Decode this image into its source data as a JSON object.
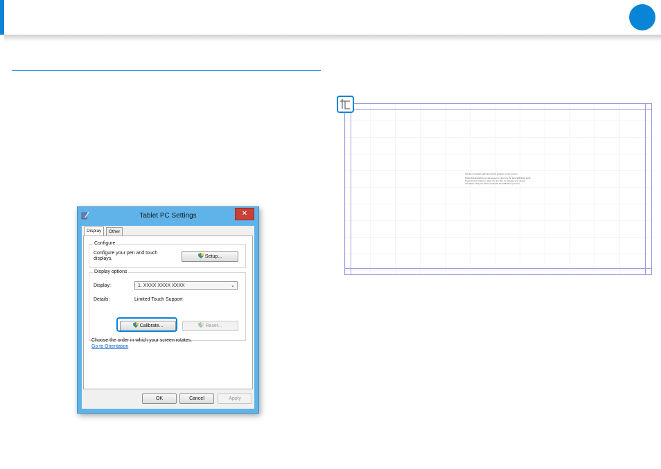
{
  "dialog": {
    "title": "Tablet PC Settings",
    "close_glyph": "✕",
    "tabs": [
      {
        "label": "Display",
        "active": true
      },
      {
        "label": "Other",
        "active": false
      }
    ],
    "configure": {
      "group_label": "Configure",
      "text": "Configure your pen and touch displays.",
      "setup_button": "Setup..."
    },
    "display_options": {
      "group_label": "Display options",
      "display_label": "Display:",
      "display_value": "1. XXXX XXXX XXXX",
      "details_label": "Details:",
      "details_value": "Limited Touch Support",
      "calibrate_button": "Calibrate...",
      "reset_button": "Reset..."
    },
    "orientation_text": "Choose the order in which your screen rotates.",
    "orientation_link": "Go to Orientation",
    "buttons": {
      "ok": "OK",
      "cancel": "Cancel",
      "apply": "Apply"
    }
  },
  "calibration": {
    "instructions": [
      "Tap the crosshair each time that it appears on the screen.",
      "Right-click anywhere on the screen to return to the last calibration point. Press the Esc button to close the tool. Do not change your screen orientation until you have completed the calibration process."
    ]
  },
  "colors": {
    "accent": "#0a84d6",
    "link": "#0d63c4",
    "close": "#c7403a"
  }
}
